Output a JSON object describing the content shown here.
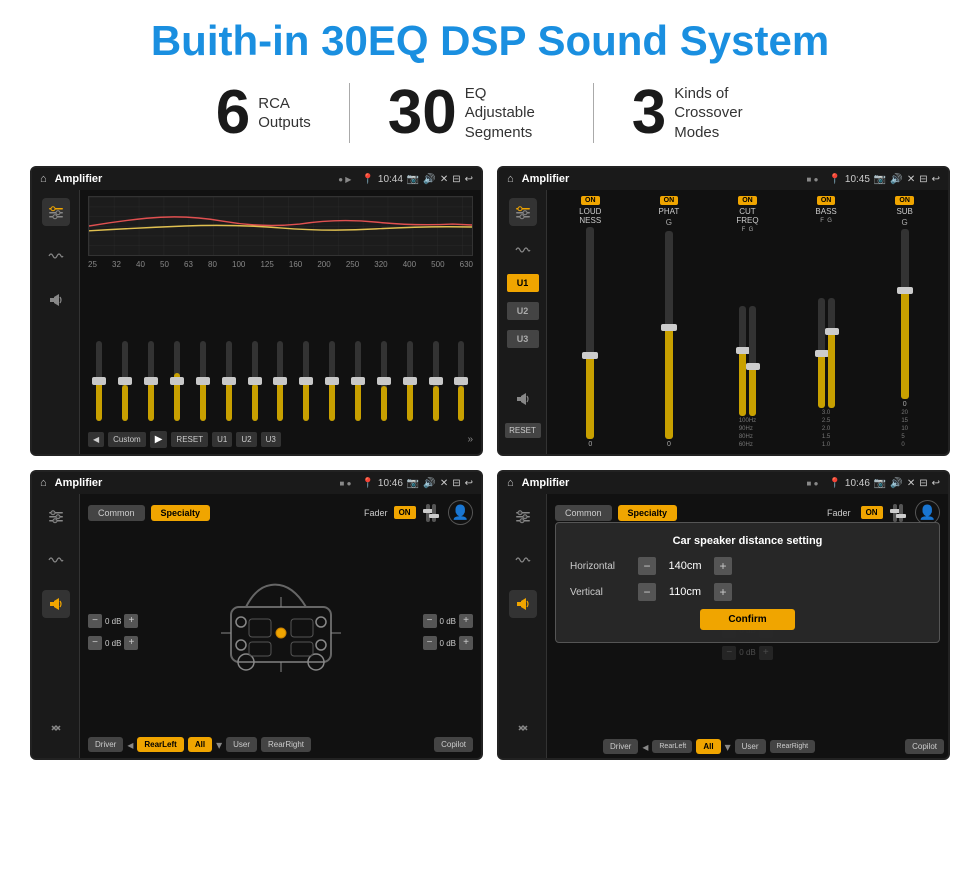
{
  "page": {
    "title": "Buith-in 30EQ DSP Sound System",
    "background": "#ffffff"
  },
  "stats": [
    {
      "number": "6",
      "label_line1": "RCA",
      "label_line2": "Outputs"
    },
    {
      "number": "30",
      "label_line1": "EQ Adjustable",
      "label_line2": "Segments"
    },
    {
      "number": "3",
      "label_line1": "Kinds of",
      "label_line2": "Crossover Modes"
    }
  ],
  "screens": {
    "screen1": {
      "title": "Amplifier",
      "time": "10:44",
      "freq_labels": [
        "25",
        "32",
        "40",
        "50",
        "63",
        "80",
        "100",
        "125",
        "160",
        "200",
        "250",
        "320",
        "400",
        "500",
        "630"
      ],
      "eq_values": [
        "0",
        "0",
        "0",
        "5",
        "0",
        "0",
        "0",
        "0",
        "0",
        "0",
        "0",
        "-1",
        "0",
        "-1"
      ],
      "buttons": [
        "Custom",
        "RESET",
        "U1",
        "U2",
        "U3"
      ]
    },
    "screen2": {
      "title": "Amplifier",
      "time": "10:45",
      "channels": [
        "LOUDNESS",
        "PHAT",
        "CUT FREQ",
        "BASS",
        "SUB"
      ],
      "on_label": "ON",
      "reset_label": "RESET",
      "u_buttons": [
        "U1",
        "U2",
        "U3"
      ]
    },
    "screen3": {
      "title": "Amplifier",
      "time": "10:46",
      "tabs": [
        "Common",
        "Specialty"
      ],
      "active_tab": "Specialty",
      "fader_label": "Fader",
      "on_label": "ON",
      "vol_rows": [
        {
          "value": "0 dB"
        },
        {
          "value": "0 dB"
        },
        {
          "value": "0 dB"
        },
        {
          "value": "0 dB"
        }
      ],
      "buttons": [
        "Driver",
        "RearLeft",
        "All",
        "User",
        "RearRight",
        "Copilot"
      ]
    },
    "screen4": {
      "title": "Amplifier",
      "time": "10:46",
      "tabs": [
        "Common",
        "Specialty"
      ],
      "dialog": {
        "title": "Car speaker distance setting",
        "horizontal_label": "Horizontal",
        "horizontal_value": "140cm",
        "vertical_label": "Vertical",
        "vertical_value": "110cm",
        "confirm_label": "Confirm"
      },
      "vol_rows": [
        {
          "value": "0 dB"
        },
        {
          "value": "0 dB"
        }
      ],
      "buttons": [
        "Driver",
        "RearLeft",
        "All",
        "User",
        "RearRight",
        "Copilot"
      ]
    }
  }
}
